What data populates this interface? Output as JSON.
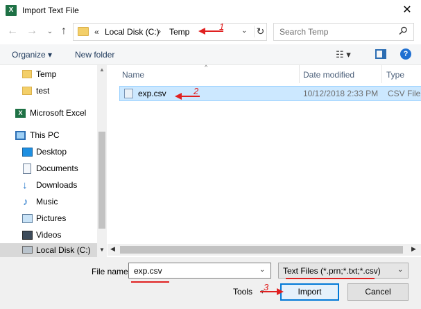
{
  "window": {
    "title": "Import Text File",
    "app_icon_letter": "X",
    "close_glyph": "✕"
  },
  "navigation": {
    "back_glyph": "←",
    "forward_glyph": "→",
    "recent_glyph": "⌄",
    "up_glyph": "↑"
  },
  "address": {
    "chevrons": "«",
    "segments": [
      "Local Disk (C:)",
      "Temp"
    ],
    "separator": "›",
    "dropdown_glyph": "⌄",
    "refresh_glyph": "↻"
  },
  "search": {
    "placeholder": "Search Temp",
    "icon": "search-icon"
  },
  "toolbar": {
    "organize_label": "Organize ▾",
    "new_folder_label": "New folder",
    "view_glyph": "☷ ▾",
    "help_glyph": "?"
  },
  "nav_pane": {
    "items": [
      {
        "label": "Temp",
        "icon": "folder-icon"
      },
      {
        "label": "test",
        "icon": "folder-icon"
      },
      {
        "label": "Microsoft Excel",
        "icon": "excel-icon"
      },
      {
        "label": "This PC",
        "icon": "computer-icon"
      },
      {
        "label": "Desktop",
        "icon": "desktop-icon"
      },
      {
        "label": "Documents",
        "icon": "documents-icon"
      },
      {
        "label": "Downloads",
        "icon": "downloads-icon"
      },
      {
        "label": "Music",
        "icon": "music-icon"
      },
      {
        "label": "Pictures",
        "icon": "pictures-icon"
      },
      {
        "label": "Videos",
        "icon": "videos-icon"
      },
      {
        "label": "Local Disk (C:)",
        "icon": "disk-icon"
      }
    ]
  },
  "file_list": {
    "columns": [
      "Name",
      "Date modified",
      "Type"
    ],
    "sort_glyph": "^",
    "files": [
      {
        "name": "exp.csv",
        "date_modified": "10/12/2018 2:33 PM",
        "type": "CSV File"
      }
    ]
  },
  "bottom": {
    "filename_label": "File name:",
    "filename_value": "exp.csv",
    "filetype_value": "Text Files (*.prn;*.txt;*.csv)",
    "tools_label": "Tools",
    "tools_glyph": "▾",
    "import_label": "Import",
    "cancel_label": "Cancel"
  },
  "annotations": {
    "step1": "1",
    "step2": "2",
    "step3": "3",
    "color": "#e02020"
  },
  "colors": {
    "selection_bg": "#cce8ff",
    "selection_border": "#99d1ff",
    "primary_button_border": "#0078d7",
    "excel_green": "#1e7145"
  }
}
